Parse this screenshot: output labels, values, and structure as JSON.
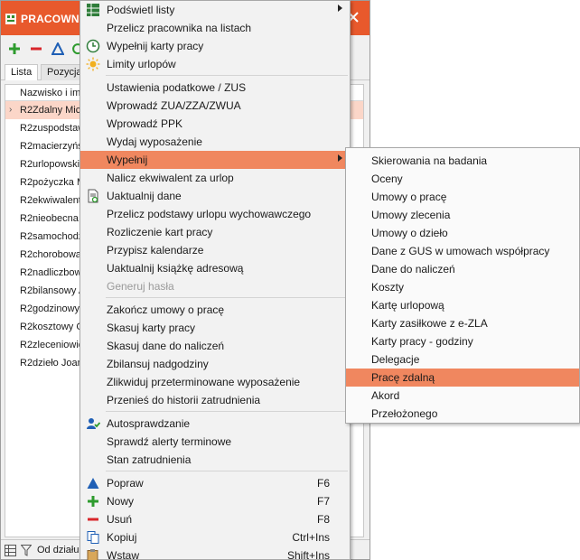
{
  "window": {
    "title": "PRACOWNIC",
    "tabs": [
      "Lista",
      "Pozycja"
    ],
    "column_header": "Nazwisko i imię",
    "rows": [
      "R2Zdalny Mich",
      "R2zuspodstaw",
      "R2macierzyńsk",
      "R2urlopowski",
      "R2pożyczka M",
      "R2ekwiwalent",
      "R2nieobecna K",
      "R2samochodzi",
      "R2chorobowa",
      "R2nadliczbowy",
      "R2bilansowy A",
      "R2godzinowy",
      "R2kosztowy G",
      "R2zleceniowie",
      "R2dzieło Joan"
    ],
    "selected_row": 0,
    "status_label": "Od działu:"
  },
  "menu": {
    "items": [
      {
        "label": "Podświetl listy",
        "submenu": true,
        "icon": "grid-highlight-icon"
      },
      {
        "label": "Przelicz pracownika na listach"
      },
      {
        "label": "Wypełnij karty pracy",
        "icon": "clock-check-icon"
      },
      {
        "label": "Limity urlopów",
        "icon": "sun-icon"
      },
      {
        "label": "Ustawienia podatkowe / ZUS"
      },
      {
        "label": "Wprowadź ZUA/ZZA/ZWUA"
      },
      {
        "label": "Wprowadź PPK"
      },
      {
        "label": "Wydaj wyposażenie"
      },
      {
        "label": "Wypełnij",
        "submenu": true,
        "highlighted": true
      },
      {
        "label": "Nalicz ekwiwalent za urlop"
      },
      {
        "label": "Uaktualnij dane",
        "icon": "document-refresh-icon"
      },
      {
        "label": "Przelicz podstawy urlopu wychowawczego"
      },
      {
        "label": "Rozliczenie kart pracy"
      },
      {
        "label": "Przypisz kalendarze"
      },
      {
        "label": "Uaktualnij książkę adresową"
      },
      {
        "label": "Generuj hasła",
        "disabled": true
      },
      {
        "label": "Zakończ umowy o pracę"
      },
      {
        "label": "Skasuj karty pracy"
      },
      {
        "label": "Skasuj dane do naliczeń"
      },
      {
        "label": "Zbilansuj nadgodziny"
      },
      {
        "label": "Zlikwiduj przeterminowane wyposażenie"
      },
      {
        "label": "Przenieś do historii zatrudnienia"
      },
      {
        "label": "Autosprawdzanie",
        "icon": "user-check-icon"
      },
      {
        "label": "Sprawdź alerty terminowe"
      },
      {
        "label": "Stan zatrudnienia"
      },
      {
        "label": "Popraw",
        "shortcut": "F6",
        "icon": "triangle-edit-icon"
      },
      {
        "label": "Nowy",
        "shortcut": "F7",
        "icon": "plus-icon"
      },
      {
        "label": "Usuń",
        "shortcut": "F8",
        "icon": "minus-icon"
      },
      {
        "label": "Kopiuj",
        "shortcut": "Ctrl+Ins",
        "icon": "copy-icon"
      },
      {
        "label": "Wstaw",
        "shortcut": "Shift+Ins",
        "icon": "paste-icon"
      }
    ]
  },
  "submenu": {
    "items": [
      "Skierowania na badania",
      "Oceny",
      "Umowy o pracę",
      "Umowy zlecenia",
      "Umowy o dzieło",
      "Dane z GUS w umowach współpracy",
      "Dane do naliczeń",
      "Koszty",
      "Kartę urlopową",
      "Karty zasiłkowe z e-ZLA",
      "Karty pracy - godziny",
      "Delegacje",
      "Pracę zdalną",
      "Akord",
      "Przełożonego"
    ],
    "highlighted_index": 12
  },
  "colors": {
    "accent": "#e8592c",
    "menu_highlight": "#f0875f",
    "selected_row": "#fbd6c8"
  }
}
